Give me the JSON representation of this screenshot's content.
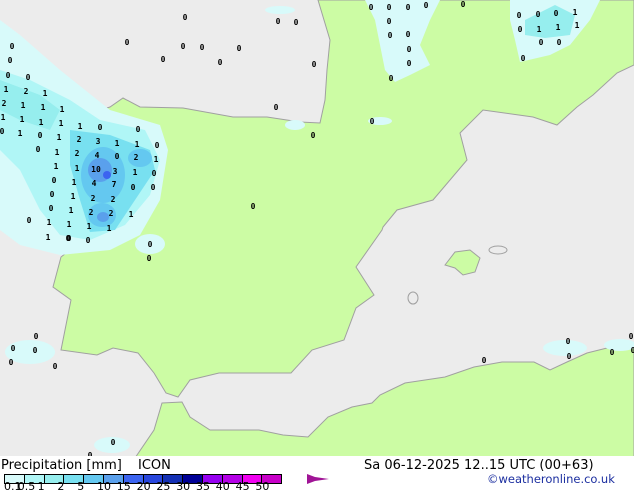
{
  "map": {
    "colors": {
      "sea": "#ececec",
      "land": "#ccfca4",
      "coast": "#a0a0a0"
    },
    "precip_labels": [
      "0",
      "0",
      "0",
      "0",
      "1",
      "2",
      "1",
      "2",
      "1",
      "1",
      "1",
      "1",
      "1",
      "1",
      "1",
      "0",
      "1",
      "0",
      "1",
      "0",
      "1",
      "1",
      "0",
      "0",
      "0",
      "0",
      "1",
      "1",
      "1",
      "0",
      "2",
      "3",
      "1",
      "1",
      "0",
      "0",
      "2",
      "4",
      "0",
      "2",
      "1",
      "1",
      "10",
      "3",
      "1",
      "0",
      "1",
      "4",
      "7",
      "0",
      "0",
      "1",
      "2",
      "2",
      "1",
      "2",
      "2",
      "1",
      "1",
      "1",
      "1",
      "0",
      "0",
      "0",
      "0",
      "0",
      "0",
      "0",
      "0",
      "0",
      "0",
      "0",
      "0",
      "0",
      "0",
      "0",
      "0",
      "0",
      "0",
      "0",
      "0",
      "0",
      "0",
      "0",
      "0",
      "0",
      "0",
      "0",
      "0",
      "0",
      "0",
      "0",
      "1",
      "0",
      "1",
      "1",
      "1",
      "0",
      "0",
      "0",
      "0",
      "0",
      "0",
      "0",
      "0",
      "0",
      "0",
      "0",
      "0",
      "0",
      "0",
      "0",
      "0",
      "0",
      "0"
    ]
  },
  "footer": {
    "title": "Precipitation [mm]",
    "model": "ICON",
    "datetime": "Sa 06-12-2025 12..15 UTC (00+63)",
    "credit": "©weatheronline.co.uk",
    "legend": {
      "ticks": [
        "0.1",
        "0.5",
        "1",
        "2",
        "5",
        "10",
        "15",
        "20",
        "25",
        "30",
        "35",
        "40",
        "45",
        "50"
      ],
      "colors": [
        "#d8fafa",
        "#b0f6f6",
        "#96eeee",
        "#78e0f0",
        "#64c8f0",
        "#5aa0ec",
        "#3c64f0",
        "#2846dc",
        "#1430b4",
        "#000096",
        "#9600f0",
        "#b400e6",
        "#f000f0",
        "#c800c8"
      ],
      "tail_color": "#a01496"
    }
  }
}
